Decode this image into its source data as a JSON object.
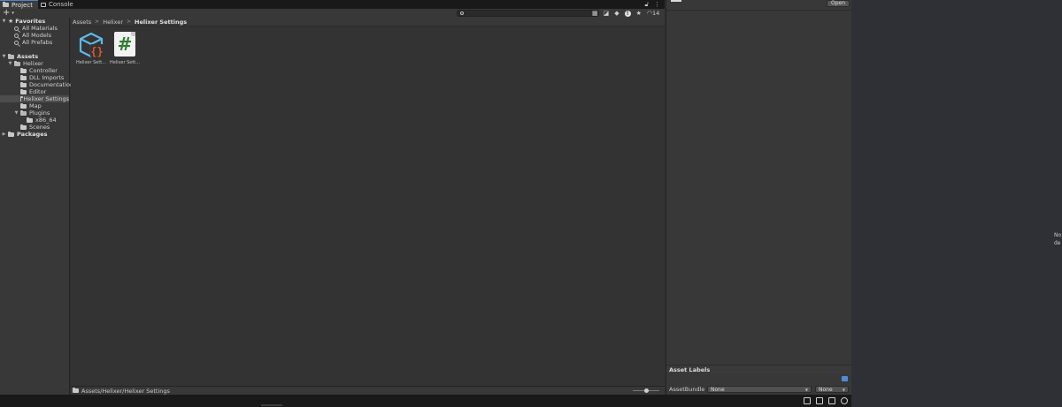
{
  "tabs": [
    {
      "label": "Project",
      "icon": "folder-icon",
      "active": true
    },
    {
      "label": "Console",
      "icon": "console-icon",
      "active": false
    }
  ],
  "tab_tools": {
    "lock_icon": "lock-icon",
    "menu_icon": "kebab-menu-icon"
  },
  "toolbar": {
    "create_label": "+",
    "create_caret": "▾",
    "search": {
      "value": "",
      "placeholder": ""
    },
    "hidden_count": "14"
  },
  "tree": {
    "favorites": {
      "label": "Favorites",
      "items": [
        {
          "label": "All Materials"
        },
        {
          "label": "All Models"
        },
        {
          "label": "All Prefabs"
        }
      ]
    },
    "assets": {
      "label": "Assets",
      "helixer": {
        "label": "Helixer",
        "children": [
          {
            "label": "Controller"
          },
          {
            "label": "DLL Imports"
          },
          {
            "label": "Documentation"
          },
          {
            "label": "Editor"
          },
          {
            "label": "Helixer Settings",
            "selected": true
          },
          {
            "label": "Map"
          },
          {
            "label": "Plugins",
            "children": [
              {
                "label": "x86_64"
              }
            ]
          },
          {
            "label": "Scenes"
          }
        ]
      }
    },
    "packages": {
      "label": "Packages"
    }
  },
  "breadcrumb": [
    "Assets",
    "Helixer",
    "Helixer Settings"
  ],
  "breadcrumb_sep": ">",
  "assets_grid": [
    {
      "label": "Helixer Sett...",
      "icon": "scriptable-object-icon"
    },
    {
      "label": "Helixer Sett...",
      "icon": "csharp-script-icon"
    }
  ],
  "script_glyph": "#",
  "path_bar": {
    "path": "Assets/Helixer/Helixer Settings",
    "zoom_fraction": 0.5
  },
  "inspector": {
    "open_button": "Open",
    "asset_labels": "Asset Labels",
    "asset_bundle_label": "AssetBundle",
    "bundle_value": "None",
    "variant_value": "None"
  },
  "right_edge_text": [
    "No",
    "de"
  ],
  "colors": {
    "accent": "#4a86c8",
    "script_green": "#2e7d32",
    "cube_blue": "#5fb8e8",
    "brace_red": "#e2542c"
  }
}
